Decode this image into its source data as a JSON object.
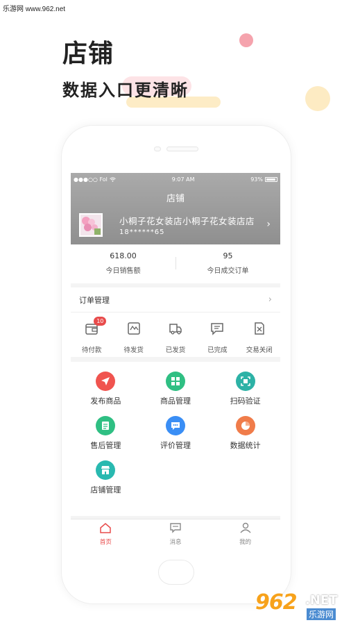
{
  "watermark_top": "乐游网 www.962.net",
  "hero": {
    "title": "店铺",
    "subtitle": "数据入口更清晰"
  },
  "statusbar": {
    "carrier": "●●●○○ Fol",
    "time": "9:07 AM",
    "battery": "93%"
  },
  "screen_title": "店铺",
  "store": {
    "name": "小桐子花女装店小桐子花女装店店",
    "phone": "18******65"
  },
  "stats": [
    {
      "value": "618.00",
      "label": "今日销售额"
    },
    {
      "value": "95",
      "label": "今日成交订单"
    }
  ],
  "order_section": {
    "title": "订单管理"
  },
  "order_items": [
    {
      "label": "待付款",
      "icon": "wallet-icon",
      "badge": "10"
    },
    {
      "label": "待发货",
      "icon": "box-icon"
    },
    {
      "label": "已发货",
      "icon": "truck-icon"
    },
    {
      "label": "已完成",
      "icon": "message-check-icon"
    },
    {
      "label": "交易关闭",
      "icon": "close-doc-icon"
    }
  ],
  "tools": [
    {
      "label": "发布商品",
      "icon": "publish-icon",
      "color": "#f0544f"
    },
    {
      "label": "商品管理",
      "icon": "product-grid-icon",
      "color": "#2fbf83"
    },
    {
      "label": "扫码验证",
      "icon": "scan-icon",
      "color": "#2db2a6"
    },
    {
      "label": "售后管理",
      "icon": "aftersale-doc-icon",
      "color": "#2fbf83"
    },
    {
      "label": "评价管理",
      "icon": "comment-icon",
      "color": "#3a8ef5"
    },
    {
      "label": "数据统计",
      "icon": "pie-chart-icon",
      "color": "#f07c4a"
    },
    {
      "label": "店铺管理",
      "icon": "store-icon",
      "color": "#29b9b0"
    }
  ],
  "tabs": [
    {
      "label": "首页",
      "icon": "home-icon",
      "active": true
    },
    {
      "label": "消息",
      "icon": "message-icon",
      "active": false
    },
    {
      "label": "我的",
      "icon": "user-icon",
      "active": false
    }
  ],
  "logo": {
    "number": "962",
    "net": ".NET",
    "cn": "乐游网"
  },
  "colors": {
    "accent_red": "#e84b4b",
    "header_gray": "#9a9a9a",
    "logo_orange": "#f7a21b"
  }
}
